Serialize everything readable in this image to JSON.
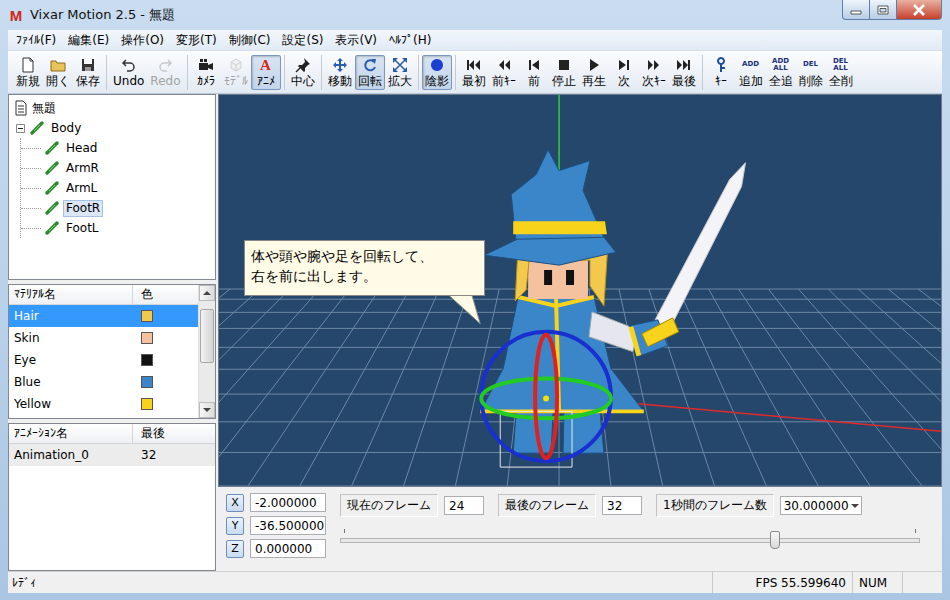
{
  "window": {
    "title": "Vixar Motion 2.5 - 無題",
    "app_icon_text": "M"
  },
  "menu": [
    {
      "label": "ﾌｧｲﾙ(F)"
    },
    {
      "label": "編集(E)"
    },
    {
      "label": "操作(O)"
    },
    {
      "label": "変形(T)"
    },
    {
      "label": "制御(C)"
    },
    {
      "label": "設定(S)"
    },
    {
      "label": "表示(V)"
    },
    {
      "label": "ﾍﾙﾌﾟ(H)"
    }
  ],
  "toolbar": [
    [
      {
        "label": "新規",
        "kind": "icon",
        "selected": false,
        "disabled": false
      },
      {
        "label": "開く",
        "kind": "icon",
        "selected": false,
        "disabled": false
      },
      {
        "label": "保存",
        "kind": "icon",
        "selected": false,
        "disabled": false
      }
    ],
    [
      {
        "label": "Undo",
        "kind": "icon",
        "selected": false,
        "disabled": false
      },
      {
        "label": "Redo",
        "kind": "icon",
        "selected": false,
        "disabled": true
      }
    ],
    [
      {
        "label": "ｶﾒﾗ",
        "kind": "icon",
        "selected": false,
        "disabled": false
      },
      {
        "label": "ﾓﾃﾞﾙ",
        "kind": "icon",
        "selected": false,
        "disabled": true
      },
      {
        "label": "ｱﾆﾒ",
        "kind": "text-icon",
        "icon_text": [
          "A"
        ],
        "selected": true,
        "disabled": false
      }
    ],
    [
      {
        "label": "中心",
        "kind": "icon",
        "selected": false,
        "disabled": false
      }
    ],
    [
      {
        "label": "移動",
        "kind": "icon",
        "selected": false,
        "disabled": false
      },
      {
        "label": "回転",
        "kind": "icon",
        "selected": true,
        "disabled": false
      },
      {
        "label": "拡大",
        "kind": "icon",
        "selected": false,
        "disabled": false
      }
    ],
    [
      {
        "label": "陰影",
        "kind": "icon",
        "selected": true,
        "disabled": false
      }
    ],
    [
      {
        "label": "最初",
        "kind": "icon",
        "selected": false,
        "disabled": false
      },
      {
        "label": "前ｷｰ",
        "kind": "icon",
        "selected": false,
        "disabled": false
      },
      {
        "label": "前",
        "kind": "icon",
        "selected": false,
        "disabled": false
      },
      {
        "label": "停止",
        "kind": "icon",
        "selected": false,
        "disabled": false
      },
      {
        "label": "再生",
        "kind": "icon",
        "selected": false,
        "disabled": false
      },
      {
        "label": "次",
        "kind": "icon",
        "selected": false,
        "disabled": false
      },
      {
        "label": "次ｷｰ",
        "kind": "icon",
        "selected": false,
        "disabled": false
      },
      {
        "label": "最後",
        "kind": "icon",
        "selected": false,
        "disabled": false
      }
    ],
    [
      {
        "label": "ｷｰ",
        "kind": "icon",
        "selected": false,
        "disabled": false
      },
      {
        "label": "追加",
        "kind": "text-icon",
        "icon_text": [
          "ADD"
        ],
        "selected": false,
        "disabled": false
      },
      {
        "label": "全追",
        "kind": "text-icon",
        "icon_text": [
          "ADD",
          "ALL"
        ],
        "selected": false,
        "disabled": false
      },
      {
        "label": "削除",
        "kind": "text-icon",
        "icon_text": [
          "DEL"
        ],
        "selected": false,
        "disabled": false
      },
      {
        "label": "全削",
        "kind": "text-icon",
        "icon_text": [
          "DEL",
          "ALL"
        ],
        "selected": false,
        "disabled": false
      }
    ]
  ],
  "tree": {
    "root": {
      "label": "無題"
    },
    "items": [
      {
        "label": "Body",
        "expanded": true,
        "selected": false,
        "children": [
          {
            "label": "Head",
            "selected": false
          },
          {
            "label": "ArmR",
            "selected": false
          },
          {
            "label": "ArmL",
            "selected": false
          },
          {
            "label": "FootR",
            "selected": true
          },
          {
            "label": "FootL",
            "selected": false
          }
        ]
      }
    ]
  },
  "materials": {
    "columns": [
      "ﾏﾃﾘｱﾙ名",
      "色"
    ],
    "rows": [
      {
        "name": "Hair",
        "color": "#f2c94c",
        "selected": true
      },
      {
        "name": "Skin",
        "color": "#f5c2a0",
        "selected": false
      },
      {
        "name": "Eye",
        "color": "#111111",
        "selected": false
      },
      {
        "name": "Blue",
        "color": "#3a86c8",
        "selected": false
      },
      {
        "name": "Yellow",
        "color": "#f7d31c",
        "selected": false
      }
    ]
  },
  "animations": {
    "columns": [
      "ｱﾆﾒｰｼｮﾝ名",
      "最後"
    ],
    "rows": [
      {
        "name": "Animation_0",
        "last": "32",
        "selected": true
      }
    ]
  },
  "viewport": {
    "callout": [
      "体や頭や腕や足を回転して、",
      "右を前に出します。"
    ]
  },
  "coords": [
    {
      "axis": "X",
      "value": "-2.000000"
    },
    {
      "axis": "Y",
      "value": "-36.500000"
    },
    {
      "axis": "Z",
      "value": "0.000000"
    }
  ],
  "frames": {
    "current": {
      "label": "現在のフレーム",
      "value": "24"
    },
    "last": {
      "label": "最後のフレーム",
      "value": "32"
    },
    "rate": {
      "label": "1秒間のフレーム数",
      "value": "30.000000"
    },
    "slider": {
      "level": 0.75
    }
  },
  "status_bar": {
    "message": "ﾚﾃﾞｨ",
    "fps": "FPS 55.599640",
    "num": "NUM"
  }
}
